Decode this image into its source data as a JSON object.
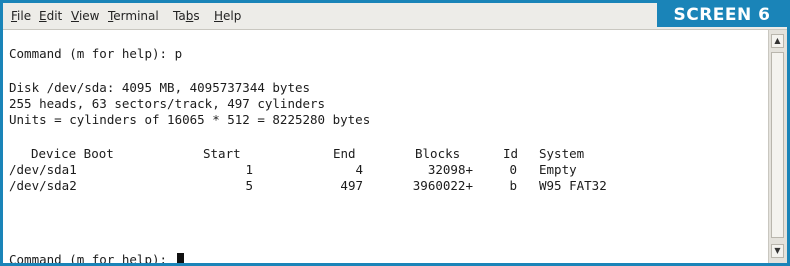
{
  "menu": {
    "items": [
      {
        "accel": "F",
        "rest": "ile"
      },
      {
        "accel": "E",
        "rest": "dit"
      },
      {
        "accel": "V",
        "rest": "iew"
      },
      {
        "accel": "T",
        "rest": "erminal"
      },
      {
        "prefix": "Ta",
        "accel": "b",
        "rest": "s"
      },
      {
        "accel": "H",
        "rest": "elp"
      }
    ]
  },
  "badge": "SCREEN 6",
  "terminal": {
    "prompt1": "Command (m for help): p",
    "disk_line": "Disk /dev/sda: 4095 MB, 4095737344 bytes",
    "geometry_line": "255 heads, 63 sectors/track, 497 cylinders",
    "units_line": "Units = cylinders of 16065 * 512 = 8225280 bytes",
    "table": {
      "headers": [
        "Device Boot",
        "Start",
        "End",
        "Blocks",
        "Id",
        "System"
      ],
      "rows": [
        [
          "/dev/sda1",
          "1",
          "4",
          "32098+",
          "0",
          "Empty"
        ],
        [
          "/dev/sda2",
          "5",
          "497",
          "3960022+",
          "b",
          "W95 FAT32"
        ]
      ]
    },
    "prompt2": "Command (m for help): "
  },
  "scrollbar": {
    "up_icon": "arrow-up-icon",
    "down_icon": "arrow-down-icon"
  },
  "colors": {
    "accent": "#1a84b8",
    "menubar_bg": "#edece8",
    "terminal_bg": "#ffffff",
    "terminal_fg": "#1c1c1c"
  }
}
